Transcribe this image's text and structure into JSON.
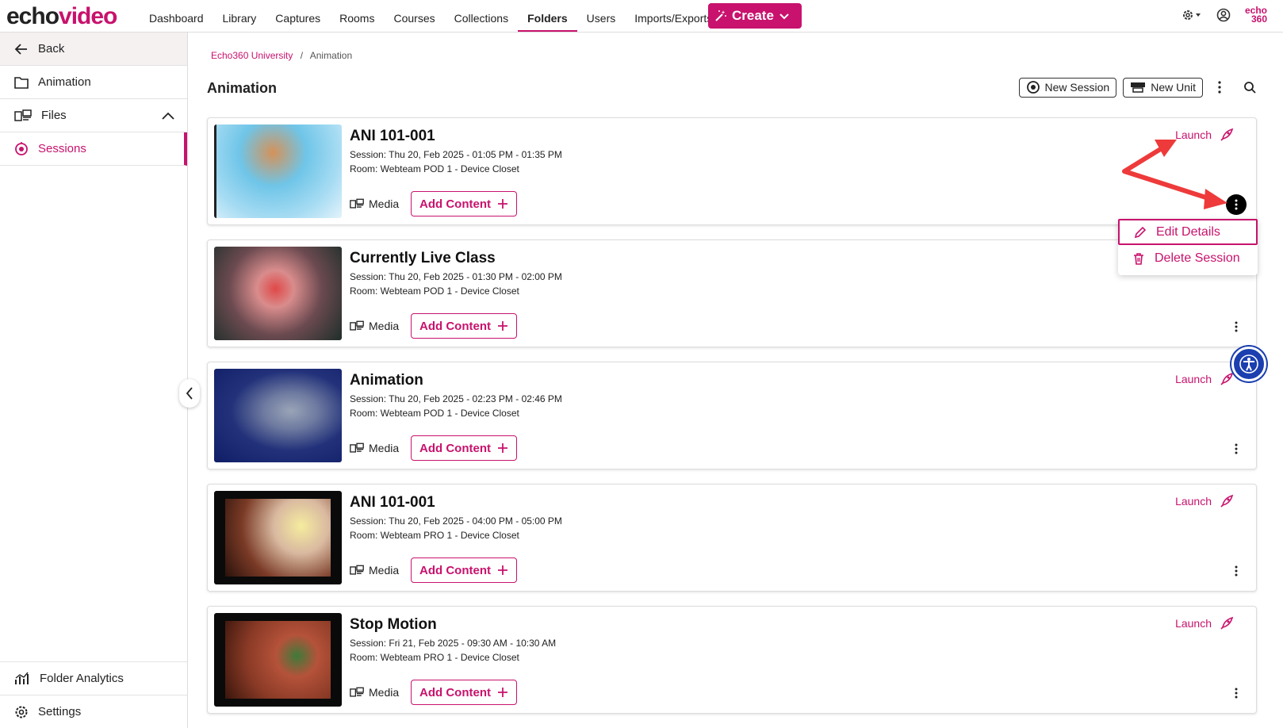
{
  "brand": {
    "echo": "echo",
    "video": "video",
    "small_logo_top": "echo",
    "small_logo_bottom": "360"
  },
  "nav": {
    "items": [
      "Dashboard",
      "Library",
      "Captures",
      "Rooms",
      "Courses",
      "Collections",
      "Folders",
      "Users",
      "Imports/Exports"
    ],
    "active": "Folders",
    "create_label": "Create"
  },
  "sidebar": {
    "back": "Back",
    "folder": "Animation",
    "files": "Files",
    "sessions": "Sessions",
    "analytics": "Folder Analytics",
    "settings": "Settings"
  },
  "breadcrumb": {
    "root": "Echo360 University",
    "separator": "/",
    "current": "Animation"
  },
  "page": {
    "title": "Animation",
    "new_session": "New Session",
    "new_unit": "New Unit"
  },
  "common": {
    "media_label": "Media",
    "add_content_label": "Add Content",
    "launch_label": "Launch"
  },
  "sessions": [
    {
      "title": "ANI 101-001",
      "session": "Session: Thu 20, Feb 2025 - 01:05 PM - 01:35 PM",
      "room": "Room: Webteam POD 1 - Device Closet",
      "launch": true
    },
    {
      "title": "Currently Live Class",
      "session": "Session: Thu 20, Feb 2025 - 01:30 PM - 02:00 PM",
      "room": "Room: Webteam POD 1 - Device Closet",
      "launch": false
    },
    {
      "title": "Animation",
      "session": "Session: Thu 20, Feb 2025 - 02:23 PM - 02:46 PM",
      "room": "Room: Webteam POD 1 - Device Closet",
      "launch": true
    },
    {
      "title": "ANI 101-001",
      "session": "Session: Thu 20, Feb 2025 - 04:00 PM - 05:00 PM",
      "room": "Room: Webteam PRO 1 - Device Closet",
      "launch": true
    },
    {
      "title": "Stop Motion",
      "session": "Session: Fri 21, Feb 2025 - 09:30 AM - 10:30 AM",
      "room": "Room: Webteam PRO 1 - Device Closet",
      "launch": true
    }
  ],
  "context_menu": {
    "edit": "Edit Details",
    "delete": "Delete Session"
  },
  "colors": {
    "accent": "#c8126d",
    "a11y": "#1b3fb0",
    "annotation": "#ee3a3a"
  }
}
